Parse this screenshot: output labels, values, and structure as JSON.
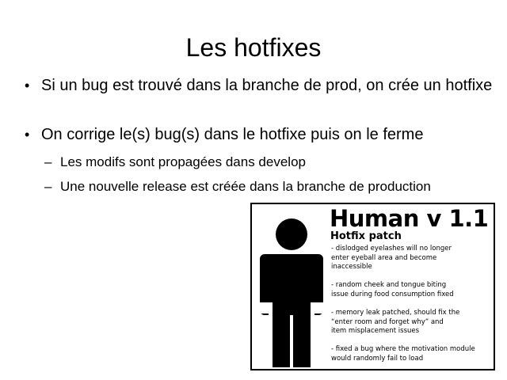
{
  "slide": {
    "title": "Les hotfixes",
    "bullets": [
      {
        "text": "Si un bug est trouvé dans la branche de prod, on crée un hotfixe"
      },
      {
        "text": "On corrige le(s) bug(s) dans le hotfixe puis on le ferme"
      }
    ],
    "sub_bullets": [
      {
        "text": "Les modifs sont propagées dans develop"
      },
      {
        "text": "Une nouvelle release est créée dans la branche de production"
      }
    ],
    "bullet_glyph": "•",
    "dash_glyph": "–"
  },
  "poster": {
    "title": "Human v 1.1",
    "subtitle": "Hotfix patch",
    "figure_icon": "person-silhouette-icon",
    "patch_notes": [
      "- dislodged eyelashes will no longer\n  enter eyeball area and become\n  inaccessible",
      "- random cheek and tongue biting\n  issue during food consumption fixed",
      "- memory leak patched, should fix the\n  “enter room and forget why” and\n  item misplacement issues",
      "- fixed a bug where the motivation module\n  would randomly fail to load"
    ]
  }
}
